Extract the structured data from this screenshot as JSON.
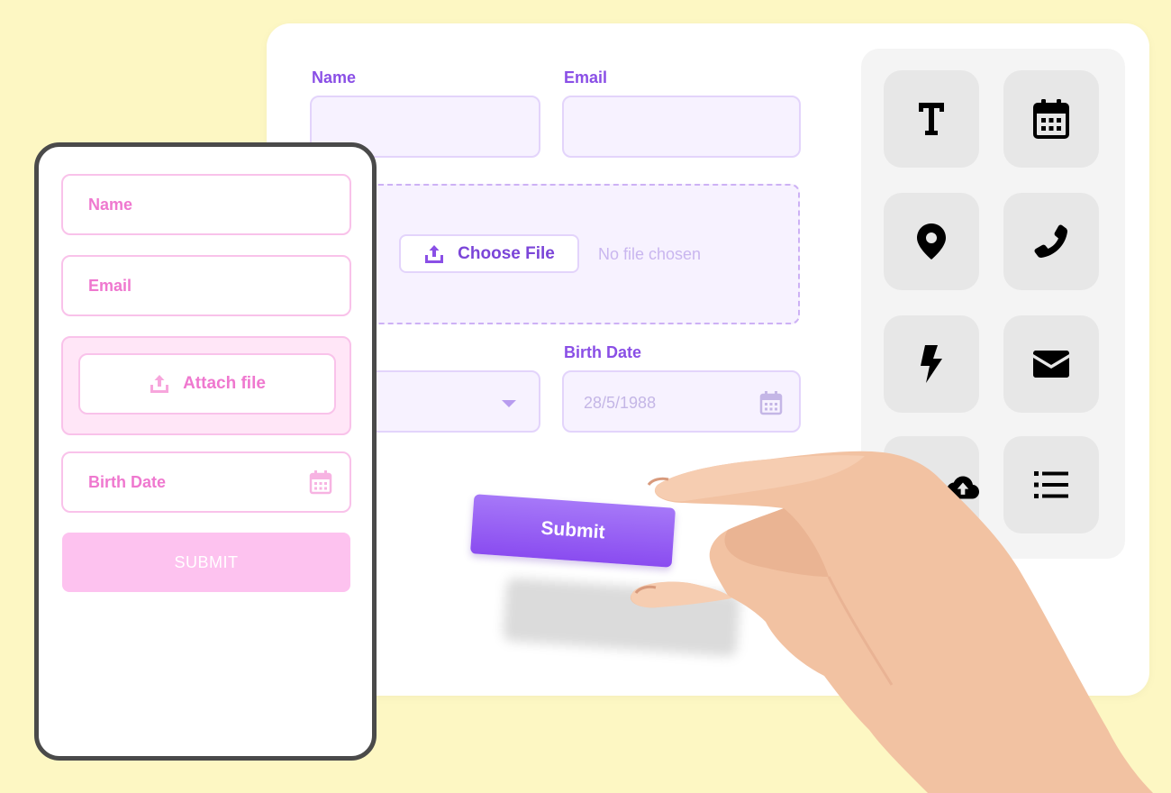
{
  "desktop_form": {
    "name_label": "Name",
    "email_label": "Email",
    "upload": {
      "button_label": "Choose File",
      "status": "No file chosen",
      "icon": "upload-icon"
    },
    "birth_date_label": "Birth Date",
    "birth_date_value": "28/5/1988",
    "dropdown_icon": "caret-down-icon",
    "calendar_icon": "calendar-icon"
  },
  "tool_palette": {
    "items": [
      {
        "icon": "text-icon"
      },
      {
        "icon": "calendar-icon"
      },
      {
        "icon": "location-pin-icon"
      },
      {
        "icon": "phone-icon"
      },
      {
        "icon": "lightning-icon"
      },
      {
        "icon": "envelope-icon"
      },
      {
        "icon": "cloud-upload-icon"
      },
      {
        "icon": "list-icon"
      }
    ]
  },
  "held_button": {
    "label": "Submit"
  },
  "mobile_form": {
    "name_placeholder": "Name",
    "email_placeholder": "Email",
    "attach_label": "Attach file",
    "birth_date_placeholder": "Birth Date",
    "submit_label": "SUBMIT"
  },
  "colors": {
    "background": "#fdf7c3",
    "accent_purple": "#8a4fe6",
    "accent_pink": "#ef78cf",
    "submit_pink": "#fdc2ef"
  }
}
